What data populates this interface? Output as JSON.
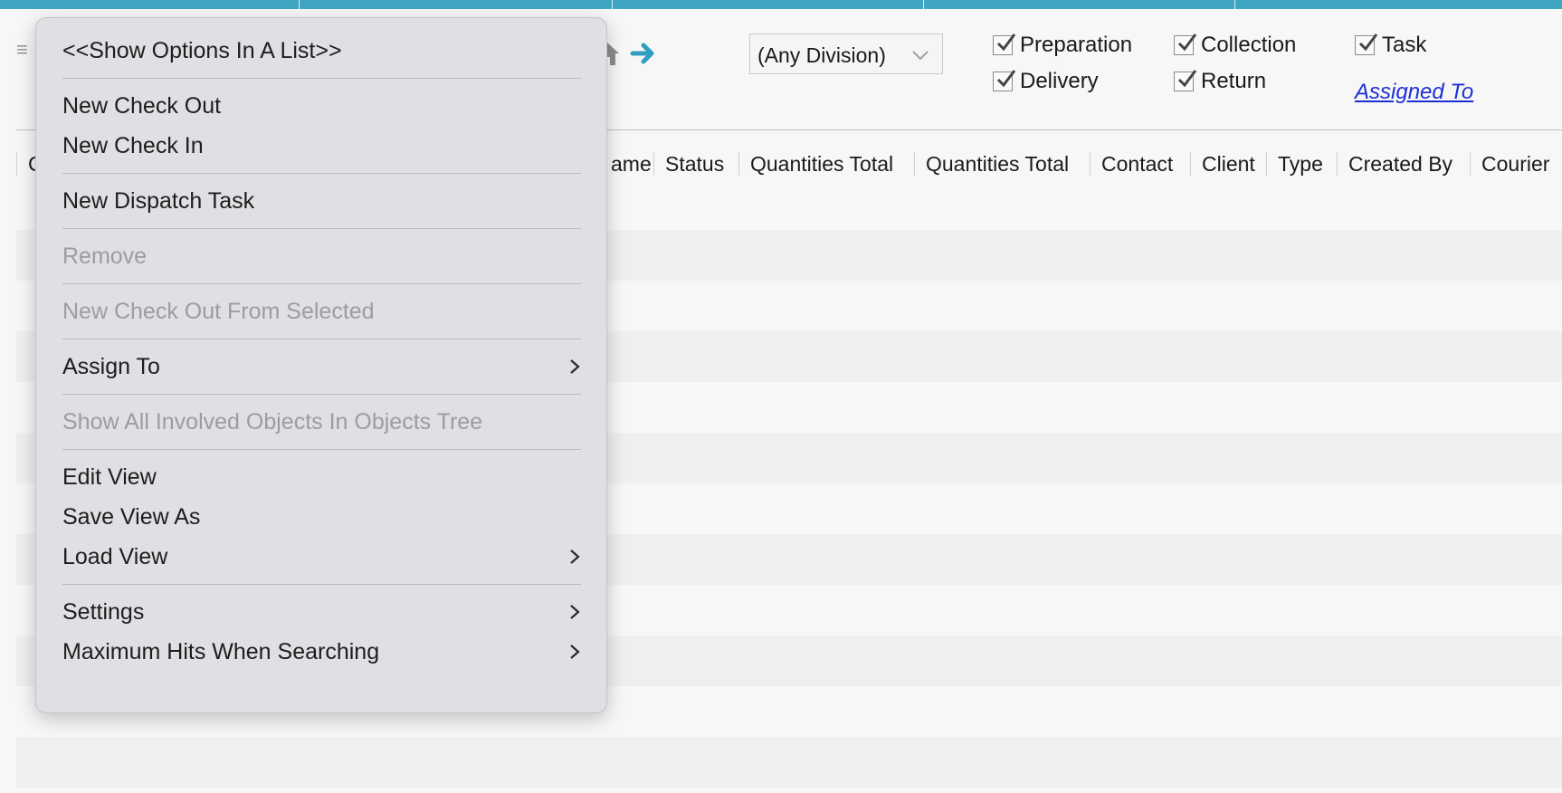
{
  "toolbar": {
    "division_select": "(Any Division)",
    "filters": {
      "preparation": "Preparation",
      "collection": "Collection",
      "task": "Task",
      "delivery": "Delivery",
      "return": "Return"
    },
    "assigned_to_link": "Assigned To"
  },
  "table": {
    "columns": [
      "C",
      "ame",
      "Status",
      "Quantities Total",
      "Quantities Total",
      "Contact",
      "Client",
      "Type",
      "Created By",
      "Courier"
    ]
  },
  "context_menu": {
    "items": [
      {
        "label": "<<Show Options In A List>>",
        "disabled": false
      },
      {
        "label": "New Check Out",
        "disabled": false
      },
      {
        "label": "New Check In",
        "disabled": false
      },
      {
        "label": "New Dispatch Task",
        "disabled": false
      },
      {
        "label": "Remove",
        "disabled": true
      },
      {
        "label": "New Check Out From Selected",
        "disabled": true
      },
      {
        "label": "Assign To",
        "disabled": false,
        "submenu": true
      },
      {
        "label": "Show All Involved Objects In Objects Tree",
        "disabled": true
      },
      {
        "label": "Edit View",
        "disabled": false
      },
      {
        "label": "Save View As",
        "disabled": false
      },
      {
        "label": "Load View",
        "disabled": false,
        "submenu": true
      },
      {
        "label": "Settings",
        "disabled": false,
        "submenu": true
      },
      {
        "label": "Maximum Hits When Searching",
        "disabled": false,
        "submenu": true
      }
    ]
  },
  "colors": {
    "accent_bar": "#3fa6c2",
    "link": "#1c2fd6",
    "menu_bg": "#dfe0e3",
    "disabled_text": "#9c9da0"
  }
}
